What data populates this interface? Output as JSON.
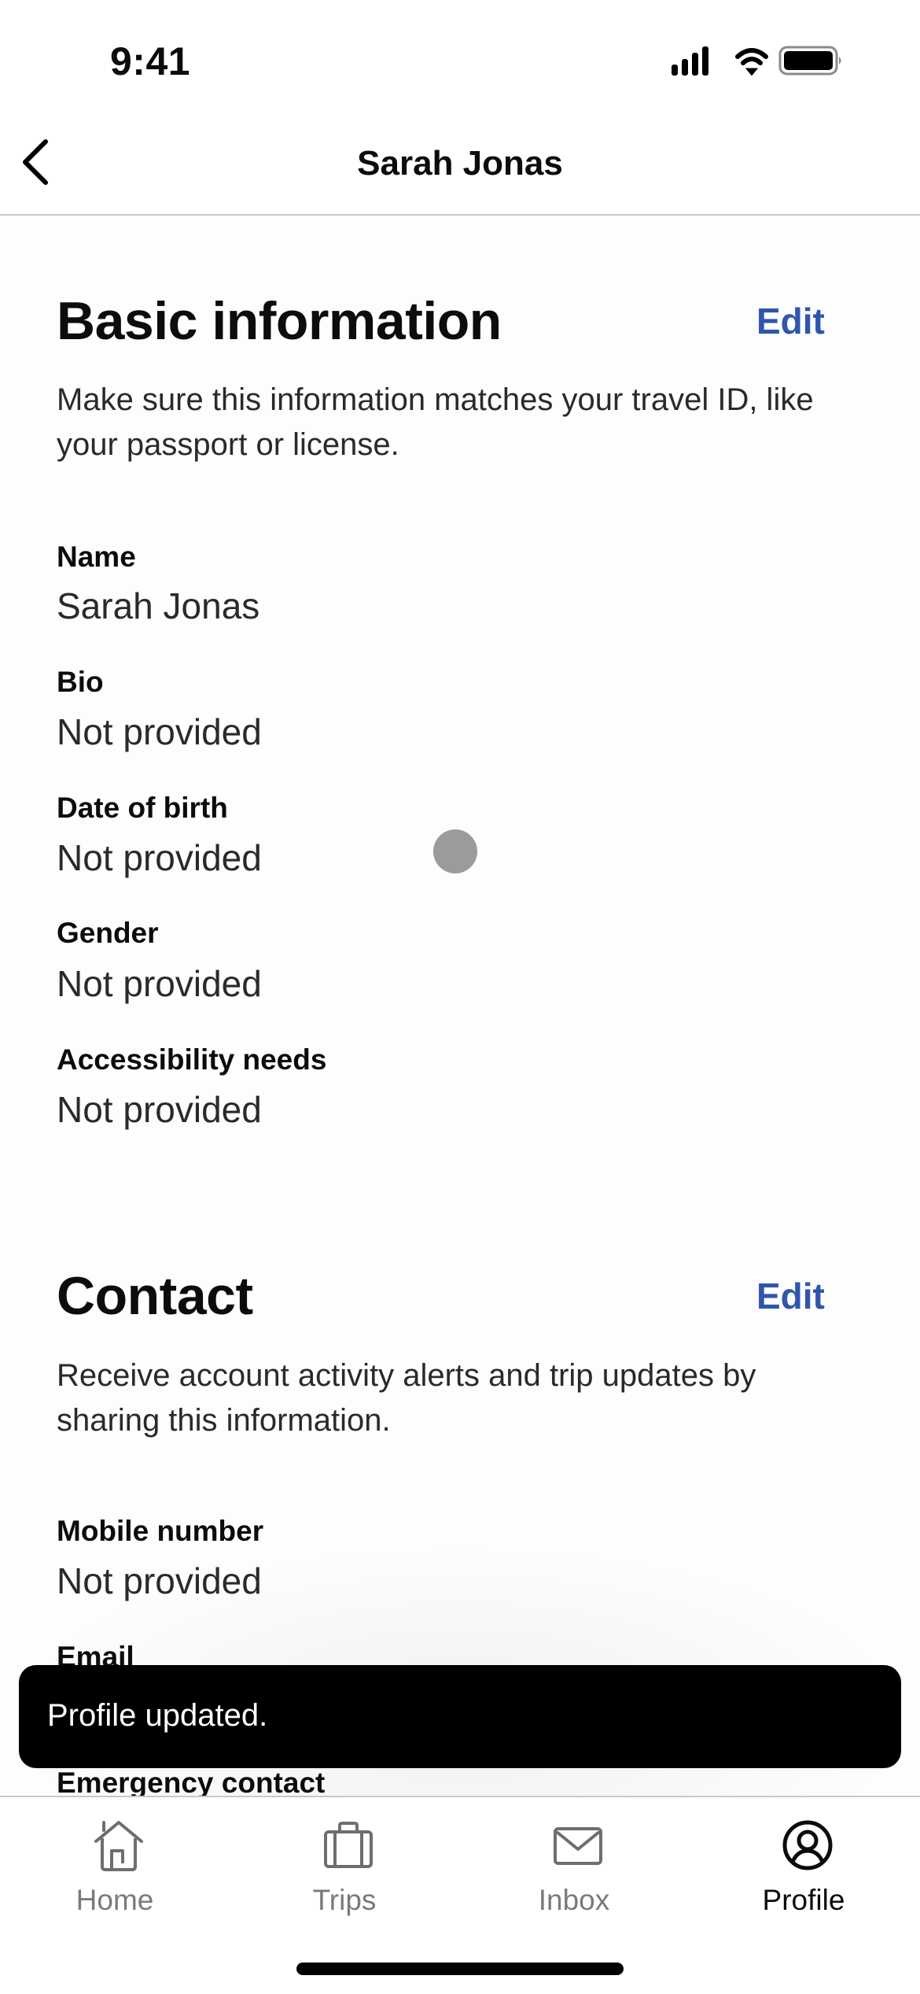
{
  "status_bar": {
    "time": "9:41",
    "icons": [
      "cellular-signal-icon",
      "wifi-icon",
      "battery-icon"
    ]
  },
  "nav": {
    "title": "Sarah Jonas",
    "back_icon": "chevron-left-icon"
  },
  "sections": {
    "basic": {
      "title": "Basic information",
      "edit_label": "Edit",
      "description": "Make sure this information matches your travel ID, like your passport or license.",
      "fields": [
        {
          "label": "Name",
          "value": "Sarah Jonas"
        },
        {
          "label": "Bio",
          "value": "Not provided"
        },
        {
          "label": "Date of birth",
          "value": "Not provided"
        },
        {
          "label": "Gender",
          "value": "Not provided"
        },
        {
          "label": "Accessibility needs",
          "value": "Not provided"
        }
      ]
    },
    "contact": {
      "title": "Contact",
      "edit_label": "Edit",
      "description": "Receive account activity alerts and trip updates by sharing this information.",
      "fields": [
        {
          "label": "Mobile number",
          "value": "Not provided"
        },
        {
          "label": "Email",
          "value": ""
        },
        {
          "label": "Emergency contact",
          "value": ""
        }
      ]
    }
  },
  "toast": {
    "message": "Profile updated."
  },
  "tabbar": {
    "active": "Profile",
    "tabs": [
      {
        "label": "Home",
        "icon": "home-icon"
      },
      {
        "label": "Trips",
        "icon": "suitcase-icon"
      },
      {
        "label": "Inbox",
        "icon": "envelope-icon"
      },
      {
        "label": "Profile",
        "icon": "user-circle-icon"
      }
    ]
  },
  "colors": {
    "accent": "#2f56ab",
    "toast_bg": "#000000",
    "tab_inactive": "#7a7a7a",
    "tab_active": "#0c0c0c"
  }
}
